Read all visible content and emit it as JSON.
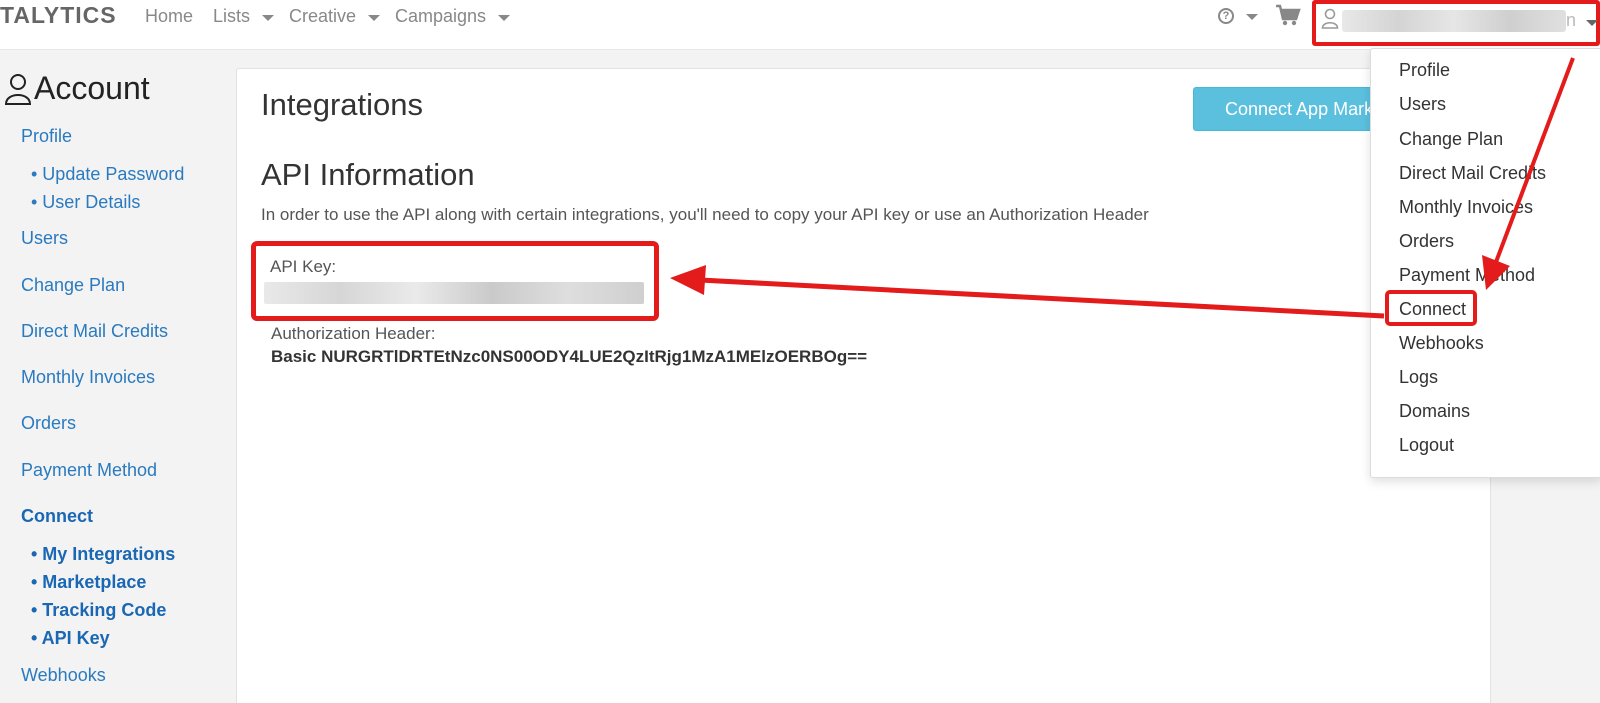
{
  "navbar": {
    "brand": "TALYTICS",
    "items": [
      {
        "label": "Home",
        "has_caret": false
      },
      {
        "label": "Lists",
        "has_caret": true
      },
      {
        "label": "Creative",
        "has_caret": true
      },
      {
        "label": "Campaigns",
        "has_caret": true
      }
    ],
    "help_icon": "?",
    "user_suffix": "n"
  },
  "sidebar": {
    "title": "Account",
    "items": {
      "profile": "Profile",
      "update_password": "• Update Password",
      "user_details": "• User Details",
      "users": "Users",
      "change_plan": "Change Plan",
      "direct_mail_credits": "Direct Mail Credits",
      "monthly_invoices": "Monthly Invoices",
      "orders": "Orders",
      "payment_method": "Payment Method",
      "connect": "Connect",
      "my_integrations": "• My Integrations",
      "marketplace": "• Marketplace",
      "tracking_code": "• Tracking Code",
      "api_key": "• API Key",
      "webhooks": "Webhooks"
    }
  },
  "main": {
    "title": "Integrations",
    "connect_button": "Connect App Marketplace",
    "api_heading": "API Information",
    "api_description": "In order to use the API along with certain integrations, you'll need to copy your API key or use an Authorization Header",
    "api_key_label": "API Key:",
    "auth_label": "Authorization Header:",
    "auth_value": "Basic NURGRTlDRTEtNzc0NS00ODY4LUE2QzItRjg1MzA1MElzOERBOg=="
  },
  "dropdown": {
    "items": [
      "Profile",
      "Users",
      "Change Plan",
      "Direct Mail Credits",
      "Monthly Invoices",
      "Orders",
      "Payment Method",
      "Connect",
      "Webhooks",
      "Logs",
      "Domains",
      "Logout"
    ]
  },
  "colors": {
    "link": "#2a7abf",
    "highlight": "#e31b1b",
    "button": "#5bc0de"
  }
}
